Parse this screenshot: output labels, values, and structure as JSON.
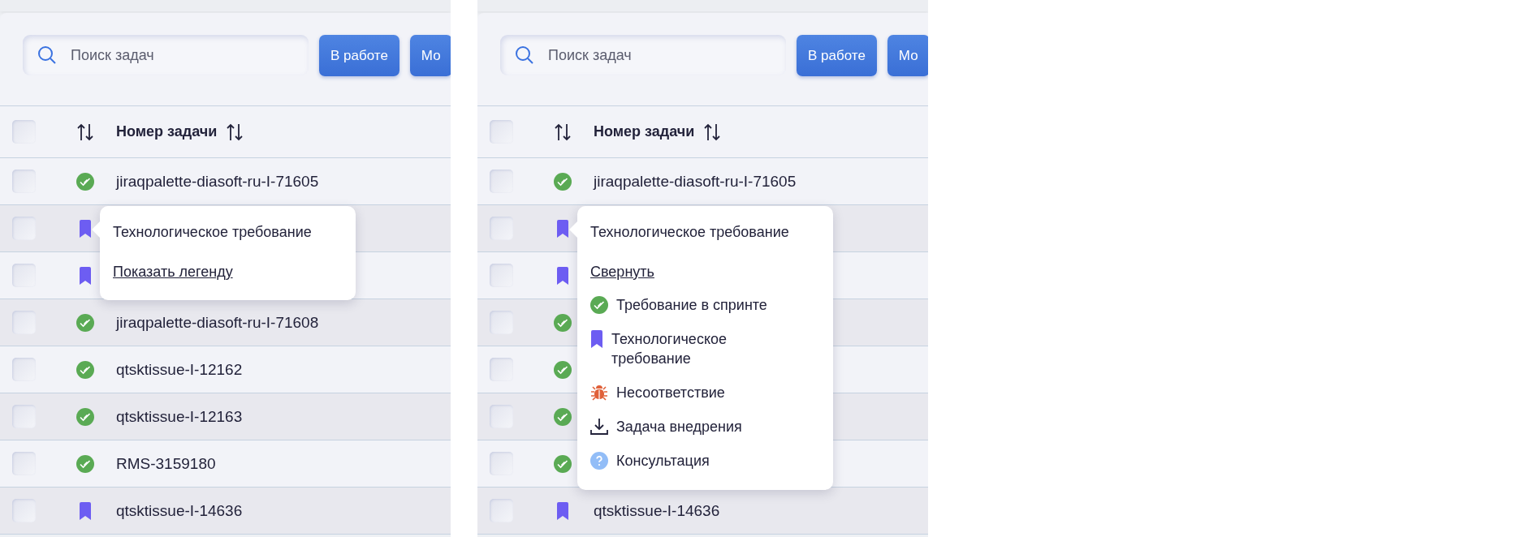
{
  "panels": [
    {
      "search": {
        "placeholder": "Поиск задач"
      },
      "buttons": [
        "В работе",
        "Мо"
      ],
      "header": {
        "checked": false,
        "column": "Номер задачи"
      },
      "rows": [
        {
          "kind": "sprint",
          "checked": false,
          "task": "jiraqpalette-diasoft-ru-I-71605"
        },
        {
          "kind": "tech",
          "checked": false
        },
        {
          "kind": "tech",
          "checked": false
        },
        {
          "kind": "sprint",
          "checked": false,
          "task": "jiraqpalette-diasoft-ru-I-71608"
        },
        {
          "kind": "sprint",
          "checked": false,
          "task": "qtsktissue-I-12162"
        },
        {
          "kind": "sprint",
          "checked": false,
          "task": "qtsktissue-I-12163"
        },
        {
          "kind": "sprint",
          "checked": false,
          "task": "RMS-3159180"
        },
        {
          "kind": "tech",
          "checked": false,
          "task": "qtsktissue-I-14636"
        }
      ],
      "popover": {
        "title": "Технологическое требование",
        "link": "Показать легенду"
      }
    },
    {
      "search": {
        "placeholder": "Поиск задач"
      },
      "buttons": [
        "В работе",
        "Мо"
      ],
      "header": {
        "checked": false,
        "column": "Номер задачи"
      },
      "rows": [
        {
          "kind": "sprint",
          "checked": false,
          "task": "jiraqpalette-diasoft-ru-I-71605"
        },
        {
          "kind": "tech",
          "checked": false
        },
        {
          "kind": "tech",
          "checked": false
        },
        {
          "kind": "sprint",
          "checked": false
        },
        {
          "kind": "sprint",
          "checked": false
        },
        {
          "kind": "sprint",
          "checked": false
        },
        {
          "kind": "sprint",
          "checked": false
        },
        {
          "kind": "tech",
          "checked": false,
          "task": "qtsktissue-I-14636"
        }
      ],
      "popover": {
        "title": "Технологическое требование",
        "link": "Свернуть",
        "legend": [
          {
            "kind": "sprint",
            "label": "Требование в спринте"
          },
          {
            "kind": "tech",
            "label": "Технологическое требование"
          },
          {
            "kind": "bug",
            "label": "Несоответствие"
          },
          {
            "kind": "deploy",
            "label": "Задача внедрения"
          },
          {
            "kind": "consult",
            "label": "Консультация"
          }
        ]
      }
    }
  ]
}
